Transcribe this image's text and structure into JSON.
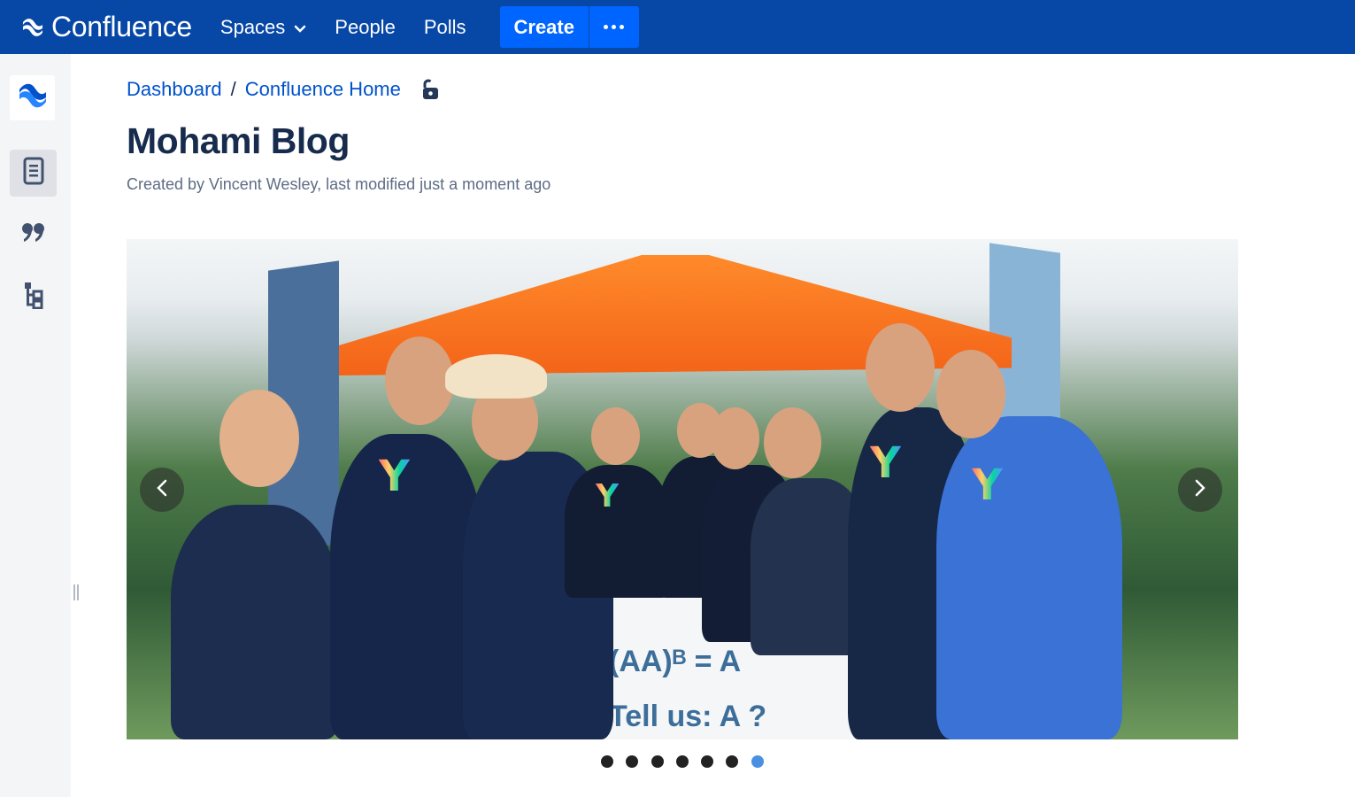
{
  "topnav": {
    "brand": "Confluence",
    "items": [
      {
        "label": "Spaces",
        "has_dropdown": true
      },
      {
        "label": "People"
      },
      {
        "label": "Polls"
      }
    ],
    "create_label": "Create",
    "more_icon": "ellipsis-icon",
    "colors": {
      "bar": "#0747a6",
      "button": "#0065ff"
    }
  },
  "sidebar": {
    "logo_icon": "confluence-logo-icon",
    "buttons": [
      {
        "icon": "page-icon",
        "active": true
      },
      {
        "icon": "quote-icon",
        "active": false
      },
      {
        "icon": "page-tree-icon",
        "active": false
      }
    ]
  },
  "breadcrumb": {
    "items": [
      "Dashboard",
      "Confluence Home"
    ],
    "separator": "/",
    "lock_icon": "unlocked-icon"
  },
  "page": {
    "title": "Mohami Blog",
    "byline": "Created by Vincent Wesley, last modified just a moment ago"
  },
  "carousel": {
    "sign_line1": "(AA)ᴮ = A",
    "sign_line2": "Tell us: A        ?",
    "prev_icon": "chevron-left-icon",
    "next_icon": "chevron-right-icon",
    "slide_count": 7,
    "active_index": 6
  }
}
